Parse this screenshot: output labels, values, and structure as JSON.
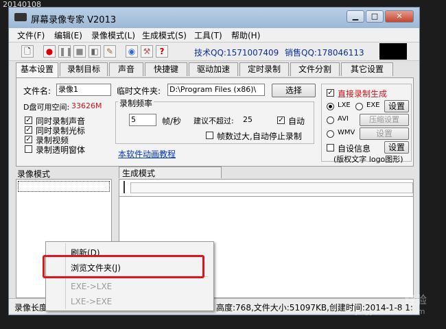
{
  "stamp": "20140108",
  "window": {
    "title": "屏幕录像专家 V2013"
  },
  "menu": [
    "文件(F)",
    "编辑(E)",
    "录像模式(L)",
    "生成模式(S)",
    "工具(T)",
    "帮助(H)"
  ],
  "toolbar": {
    "tech_qq": "技术QQ:1571007409",
    "sales_qq": "销售QQ:178046113"
  },
  "tabs": [
    "基本设置",
    "录制目标",
    "声音",
    "快捷键",
    "驱动加速",
    "定时录制",
    "文件分割",
    "其它设置"
  ],
  "basic": {
    "filename_label": "文件名:",
    "filename_value": "录像1",
    "tempdir_label": "临时文件夹:",
    "tempdir_value": "D:\\Program Files (x86)\\",
    "browse_button": "选择",
    "disk_label": "D盘可用空间:",
    "disk_value": "33626M",
    "checks": [
      "同时录制声音",
      "同时录制光标",
      "录制视频",
      "录制透明窗体"
    ],
    "freq_title": "录制频率",
    "fps_value": "5",
    "fps_unit": "帧/秒",
    "suggest_label": "建议不超过:",
    "suggest_value": "25",
    "auto_label": "自动",
    "overflow_label": "帧数过大,自动停止录制",
    "tutorial_link": "本软件动画教程",
    "direct_label": "直接录制生成",
    "format_options": [
      "LXE",
      "EXE",
      "AVI",
      "WMV"
    ],
    "settings_label": "设置",
    "compress_label": "压缩设置",
    "custom_info_label": "自设信息",
    "copyright_label": "(版权文字 logo图形)"
  },
  "lower": {
    "record_mode": "录像模式",
    "gen_mode": "生成模式"
  },
  "context_menu": {
    "items": [
      "刷新(D)",
      "浏览文件夹(J)",
      "EXE->LXE",
      "LXE->EXE"
    ]
  },
  "status": {
    "left": "录像长度",
    "right": "高度:768,文件大小:51097KB,创建时间:2014-1-8 1:"
  },
  "watermark": {
    "text": "经验",
    "url": "jingyan.baidu.com"
  }
}
